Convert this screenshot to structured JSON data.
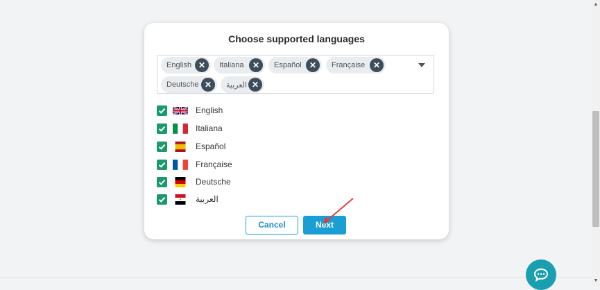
{
  "dialog": {
    "title": "Choose supported languages",
    "selected_chips": [
      {
        "label": "English"
      },
      {
        "label": "Italiana"
      },
      {
        "label": "Español"
      },
      {
        "label": "Française"
      },
      {
        "label": "Deutsche"
      },
      {
        "label": "العربية"
      }
    ],
    "languages": [
      {
        "label": "English",
        "checked": true,
        "flag_icon": "uk-flag-icon"
      },
      {
        "label": "Italiana",
        "checked": true,
        "flag_icon": "italy-flag-icon"
      },
      {
        "label": "Español",
        "checked": true,
        "flag_icon": "spain-flag-icon"
      },
      {
        "label": "Française",
        "checked": true,
        "flag_icon": "france-flag-icon"
      },
      {
        "label": "Deutsche",
        "checked": true,
        "flag_icon": "germany-flag-icon"
      },
      {
        "label": "العربية",
        "checked": true,
        "flag_icon": "egypt-flag-icon"
      }
    ],
    "buttons": {
      "cancel": "Cancel",
      "next": "Next"
    }
  },
  "colors": {
    "primary": "#1a9fd4",
    "checkbox": "#1a9a6c",
    "chip_bg": "#e9edf0",
    "chip_remove": "#3e4d5c",
    "chat": "#1a9fb0",
    "annotation_arrow": "#e03c3c"
  }
}
